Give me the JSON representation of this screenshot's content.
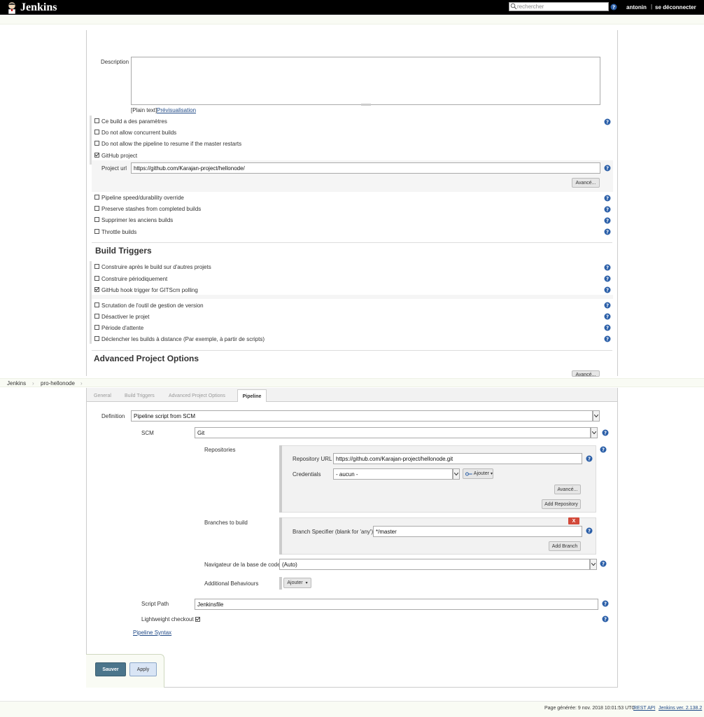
{
  "header": {
    "app_title": "Jenkins",
    "search_placeholder": "rechercher",
    "user": "antonin",
    "separator": "|",
    "logout": "se déconnecter"
  },
  "general": {
    "description_label": "Description",
    "plain_text": "[Plain text]",
    "preview_link": "Prévisualisation",
    "options": [
      {
        "label": "Ce build a des paramètres",
        "checked": false
      },
      {
        "label": "Do not allow concurrent builds",
        "checked": false
      },
      {
        "label": "Do not allow the pipeline to resume if the master restarts",
        "checked": false
      },
      {
        "label": "GitHub project",
        "checked": true
      }
    ],
    "project_url_label": "Project url",
    "project_url_value": "https://github.com/Karajan-project/hellonode/",
    "advanced_button": "Avancé...",
    "options2": [
      {
        "label": "Pipeline speed/durability override",
        "checked": false
      },
      {
        "label": "Preserve stashes from completed builds",
        "checked": false
      },
      {
        "label": "Supprimer les anciens builds",
        "checked": false
      },
      {
        "label": "Throttle builds",
        "checked": false
      }
    ]
  },
  "build_triggers": {
    "title": "Build Triggers",
    "items": [
      {
        "label": "Construire après le build sur d'autres projets",
        "checked": false
      },
      {
        "label": "Construire périodiquement",
        "checked": false
      },
      {
        "label": "GitHub hook trigger for GITScm polling",
        "checked": true
      },
      {
        "label": "Scrutation de l'outil de gestion de version",
        "checked": false
      },
      {
        "label": "Désactiver le projet",
        "checked": false
      },
      {
        "label": "Période d'attente",
        "checked": false
      },
      {
        "label": "Déclencher les builds à distance (Par exemple, à partir de scripts)",
        "checked": false
      }
    ]
  },
  "advanced_options": {
    "title": "Advanced Project Options",
    "advanced_button": "Avancé..."
  },
  "breadcrumb": {
    "items": [
      "Jenkins",
      "pro-hellonode"
    ],
    "arrow": "›"
  },
  "tabs": [
    {
      "label": "General",
      "active": false
    },
    {
      "label": "Build Triggers",
      "active": false
    },
    {
      "label": "Advanced Project Options",
      "active": false
    },
    {
      "label": "Pipeline",
      "active": true
    }
  ],
  "pipeline": {
    "definition_label": "Definition",
    "definition_value": "Pipeline script from SCM",
    "scm_label": "SCM",
    "scm_value": "Git",
    "repositories_label": "Repositories",
    "repo_url_label": "Repository URL",
    "repo_url_value": "https://github.com/Karajan-project/hellonode.git",
    "credentials_label": "Credentials",
    "credentials_value": "- aucun -",
    "add_button": "Ajouter",
    "advanced_button": "Avancé...",
    "add_repository_button": "Add Repository",
    "branches_label": "Branches to build",
    "delete_button": "X",
    "branch_specifier_label": "Branch Specifier (blank for 'any')",
    "branch_specifier_value": "*/master",
    "add_branch_button": "Add Branch",
    "browser_label": "Navigateur de la base de code",
    "browser_value": "(Auto)",
    "additional_behaviours_label": "Additional Behaviours",
    "add_behaviour_button": "Ajouter",
    "script_path_label": "Script Path",
    "script_path_value": "Jenkinsfile",
    "lightweight_label": "Lightweight checkout",
    "lightweight_checked": true,
    "pipeline_syntax_link": "Pipeline Syntax"
  },
  "actions": {
    "save_button": "Sauver",
    "apply_button": "Apply"
  },
  "footer": {
    "generated": "Page générée: 9 nov. 2018 10:01:53 UTC",
    "rest_api": "REST API",
    "version": "Jenkins ver. 2.138.2"
  },
  "colors": {
    "header_bg": "#000000",
    "help_icon": "#2b5fa8",
    "save_button": "#4b758b",
    "apply_button": "#d9e5f5",
    "delete_button": "#d24939",
    "link": "#204a87"
  }
}
